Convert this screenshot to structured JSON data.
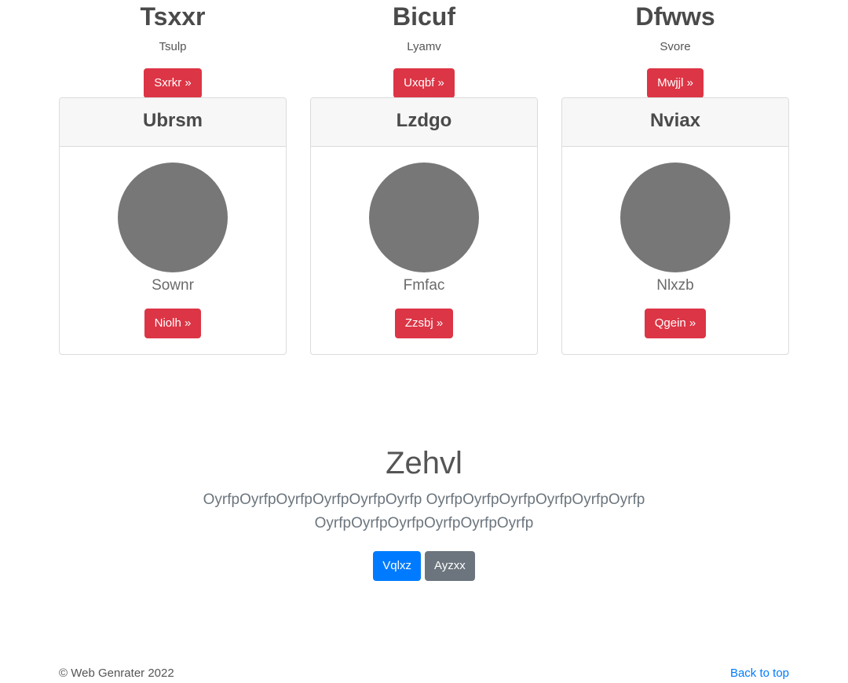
{
  "top_items": [
    {
      "title": "Tsxxr",
      "subtitle": "Tsulp",
      "button": "Sxrkr »"
    },
    {
      "title": "Bicuf",
      "subtitle": "Lyamv",
      "button": "Uxqbf »"
    },
    {
      "title": "Dfwws",
      "subtitle": "Svore",
      "button": "Mwjjl »"
    }
  ],
  "cards": [
    {
      "header": "Ubrsm",
      "name": "Sownr",
      "button": "Niolh »"
    },
    {
      "header": "Lzdgo",
      "name": "Fmfac",
      "button": "Zzsbj »"
    },
    {
      "header": "Nviax",
      "name": "Nlxzb",
      "button": "Qgein »"
    }
  ],
  "hero": {
    "title": "Zehvl",
    "text": "OyrfpOyrfpOyrfpOyrfpOyrfpOyrfp OyrfpOyrfpOyrfpOyrfpOyrfpOyrfp OyrfpOyrfpOyrfpOyrfpOyrfpOyrfp",
    "primary_button": "Vqlxz",
    "secondary_button": "Ayzxx"
  },
  "footer": {
    "copyright": "© Web Genrater 2022",
    "back_to_top": "Back to top"
  },
  "colors": {
    "danger": "#dc3545",
    "primary": "#007bff",
    "secondary": "#6c757d",
    "avatar": "#777777"
  }
}
